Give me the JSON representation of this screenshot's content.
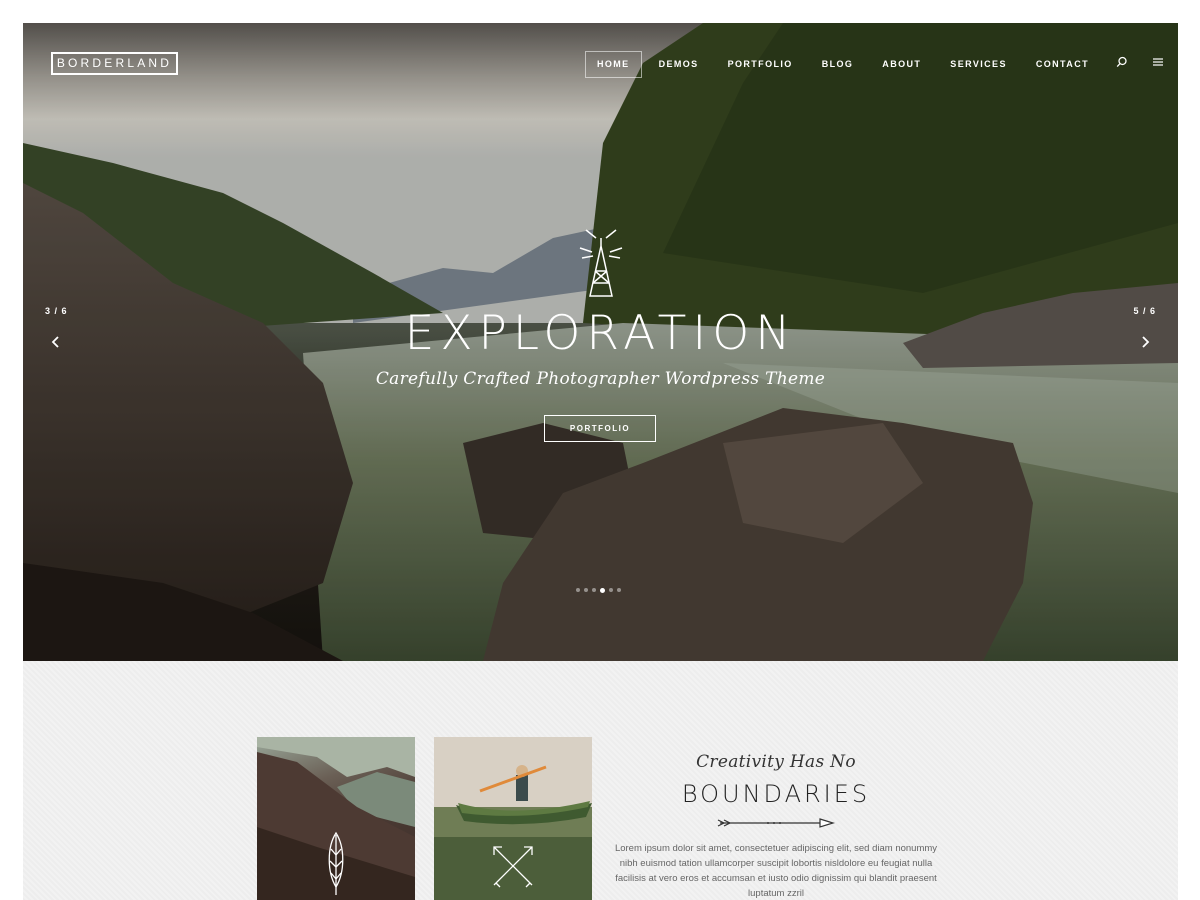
{
  "header": {
    "logo": "BORDERLAND",
    "nav": [
      {
        "label": "HOME",
        "active": true
      },
      {
        "label": "DEMOS",
        "active": false
      },
      {
        "label": "PORTFOLIO",
        "active": false
      },
      {
        "label": "BLOG",
        "active": false
      },
      {
        "label": "ABOUT",
        "active": false
      },
      {
        "label": "SERVICES",
        "active": false
      },
      {
        "label": "CONTACT",
        "active": false
      }
    ],
    "icons": [
      "search-icon",
      "menu-icon"
    ]
  },
  "slider": {
    "prev_counter": "3 / 6",
    "next_counter": "5 / 6",
    "title": "EXPLORATION",
    "subtitle": "Carefully Crafted Photographer Wordpress Theme",
    "button_label": "PORTFOLIO",
    "current_slide": 4,
    "total_slides": 6
  },
  "intro": {
    "script_title": "Creativity Has No",
    "title": "BOUNDARIES",
    "body": "Lorem ipsum dolor sit amet, consectetuer adipiscing elit, sed diam nonummy nibh euismod tation ullamcorper suscipit lobortis nisldolore eu feugiat nulla facilisis at vero eros et accumsan et iusto odio dignissim qui blandit praesent luptatum zzril"
  },
  "colors": {
    "accent": "#ffffff",
    "section_bg": "#f2f2f2",
    "text_dark": "#222222"
  }
}
